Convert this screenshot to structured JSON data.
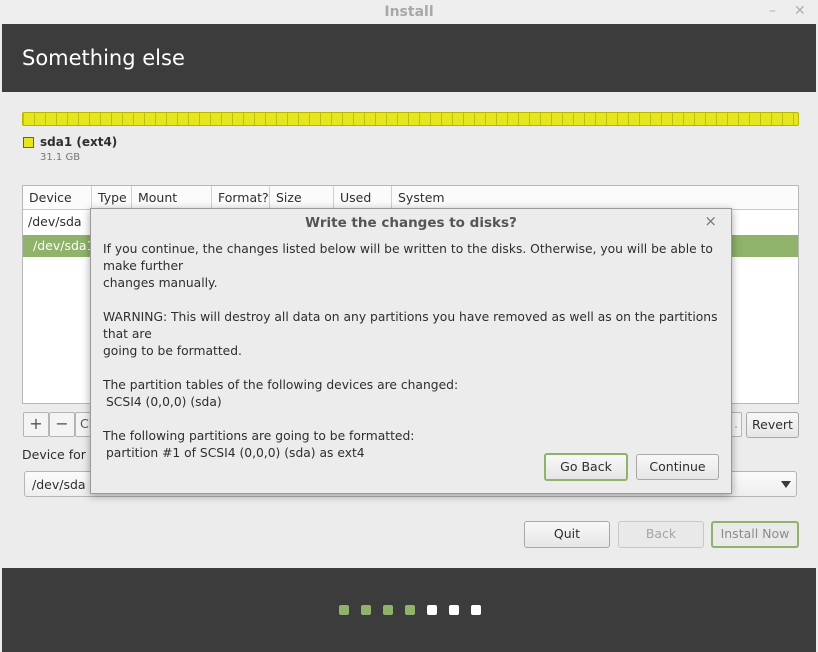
{
  "window": {
    "title": "Install",
    "minimize_glyph": "–",
    "close_glyph": "✕"
  },
  "header": {
    "title": "Something else"
  },
  "disk": {
    "bar_color": "#e6e61e",
    "partition_name": "sda1 (ext4)",
    "partition_size": "31.1 GB"
  },
  "table": {
    "columns": [
      "Device",
      "Type",
      "Mount point",
      "Format?",
      "Size",
      "Used",
      "System"
    ],
    "rows": [
      {
        "device": "/dev/sda"
      },
      {
        "device": "/dev/sda1",
        "selected": true
      }
    ]
  },
  "toolbar": {
    "add": "+",
    "remove": "−",
    "change_partial": "Ch",
    "ellipsis": ".",
    "revert": "Revert"
  },
  "bootloader": {
    "label_partial": "Device for b",
    "selected": "/dev/sda"
  },
  "buttons": {
    "quit": "Quit",
    "back": "Back",
    "install_now": "Install Now"
  },
  "progress": {
    "steps_total": 7,
    "steps_done": 4,
    "done_color": "#8fb36a",
    "todo_color": "#ffffff"
  },
  "dialog": {
    "title": "Write the changes to disks?",
    "close_glyph": "×",
    "para1_line1": "If you continue, the changes listed below will be written to the disks. Otherwise, you will be able to make further",
    "para1_line2": "changes manually.",
    "para2_line1": "WARNING: This will destroy all data on any partitions you have removed as well as on the partitions that are",
    "para2_line2": "going to be formatted.",
    "para3_heading": "The partition tables of the following devices are changed:",
    "para3_item": "SCSI4 (0,0,0) (sda)",
    "para4_heading": "The following partitions are going to be formatted:",
    "para4_item": "partition #1 of SCSI4 (0,0,0) (sda) as ext4",
    "go_back": "Go Back",
    "continue": "Continue"
  }
}
